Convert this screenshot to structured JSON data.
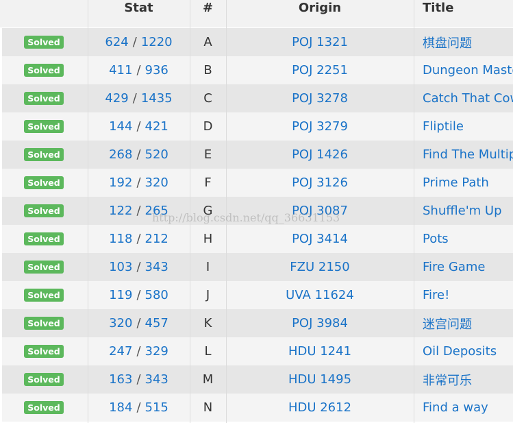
{
  "columns": {
    "status": "",
    "stat": "Stat",
    "num": "#",
    "origin": "Origin",
    "title": "Title"
  },
  "status_badge": "Solved",
  "stat_separator": "/",
  "watermark": "http://blog.csdn.net/qq_36631153",
  "rows": [
    {
      "solved": "624",
      "submitted": "1220",
      "num": "A",
      "origin": "POJ 1321",
      "title": "棋盘问题"
    },
    {
      "solved": "411",
      "submitted": "936",
      "num": "B",
      "origin": "POJ 2251",
      "title": "Dungeon Master"
    },
    {
      "solved": "429",
      "submitted": "1435",
      "num": "C",
      "origin": "POJ 3278",
      "title": "Catch That Cow"
    },
    {
      "solved": "144",
      "submitted": "421",
      "num": "D",
      "origin": "POJ 3279",
      "title": "Fliptile"
    },
    {
      "solved": "268",
      "submitted": "520",
      "num": "E",
      "origin": "POJ 1426",
      "title": "Find The Multiple"
    },
    {
      "solved": "192",
      "submitted": "320",
      "num": "F",
      "origin": "POJ 3126",
      "title": "Prime Path"
    },
    {
      "solved": "122",
      "submitted": "265",
      "num": "G",
      "origin": "POJ 3087",
      "title": "Shuffle'm Up"
    },
    {
      "solved": "118",
      "submitted": "212",
      "num": "H",
      "origin": "POJ 3414",
      "title": "Pots"
    },
    {
      "solved": "103",
      "submitted": "343",
      "num": "I",
      "origin": "FZU 2150",
      "title": "Fire Game"
    },
    {
      "solved": "119",
      "submitted": "580",
      "num": "J",
      "origin": "UVA 11624",
      "title": "Fire!"
    },
    {
      "solved": "320",
      "submitted": "457",
      "num": "K",
      "origin": "POJ 3984",
      "title": "迷宫问题"
    },
    {
      "solved": "247",
      "submitted": "329",
      "num": "L",
      "origin": "HDU 1241",
      "title": "Oil Deposits"
    },
    {
      "solved": "163",
      "submitted": "343",
      "num": "M",
      "origin": "HDU 1495",
      "title": "非常可乐"
    },
    {
      "solved": "184",
      "submitted": "515",
      "num": "N",
      "origin": "HDU 2612",
      "title": "Find a way"
    }
  ]
}
